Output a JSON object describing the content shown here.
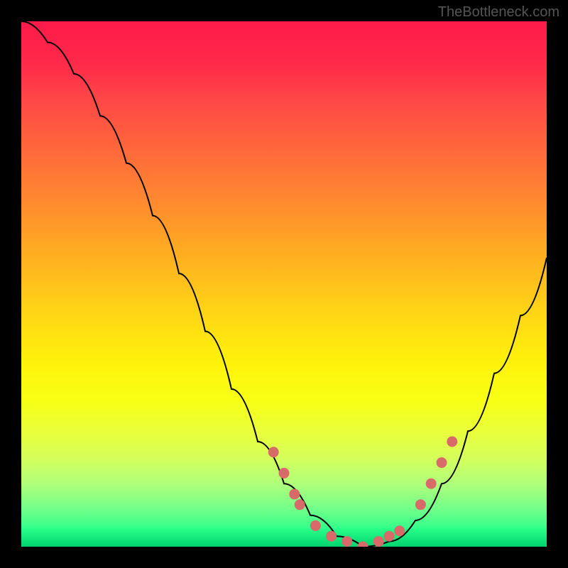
{
  "watermark": "TheBottleneck.com",
  "chart_data": {
    "type": "line",
    "title": "",
    "xlabel": "",
    "ylabel": "",
    "xlim": [
      0,
      100
    ],
    "ylim": [
      0,
      100
    ],
    "grid": false,
    "legend": false,
    "series": [
      {
        "name": "bottleneck-curve",
        "x": [
          0,
          5,
          10,
          15,
          20,
          25,
          30,
          35,
          40,
          45,
          50,
          55,
          60,
          65,
          70,
          75,
          80,
          85,
          90,
          95,
          100
        ],
        "y": [
          100,
          96,
          90,
          82,
          73,
          63,
          52,
          41,
          30,
          20,
          12,
          6,
          2,
          0,
          1,
          5,
          12,
          22,
          33,
          44,
          55
        ]
      }
    ],
    "highlighted_points": {
      "name": "dots",
      "x": [
        48,
        50,
        52,
        53,
        56,
        59,
        62,
        65,
        68,
        70,
        72,
        76,
        78,
        80,
        82
      ],
      "y": [
        18,
        14,
        10,
        8,
        4,
        2,
        1,
        0,
        1,
        2,
        3,
        8,
        12,
        16,
        20
      ]
    },
    "gradient_stops": [
      {
        "pos": 0,
        "color": "#ff1a4a"
      },
      {
        "pos": 50,
        "color": "#ffd416"
      },
      {
        "pos": 100,
        "color": "#00e07a"
      }
    ]
  }
}
